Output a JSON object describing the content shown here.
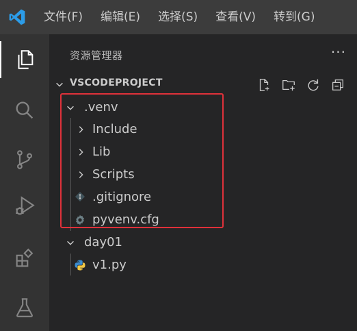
{
  "menu": {
    "items": [
      {
        "label": "文件(F)"
      },
      {
        "label": "编辑(E)"
      },
      {
        "label": "选择(S)"
      },
      {
        "label": "查看(V)"
      },
      {
        "label": "转到(G)"
      }
    ]
  },
  "activity_bar": {
    "items": [
      "explorer-icon",
      "search-icon",
      "source-control-icon",
      "run-debug-icon",
      "extensions-icon",
      "testing-icon"
    ],
    "active": "explorer-icon"
  },
  "sidebar": {
    "title": "资源管理器",
    "more_label": "···",
    "section": {
      "title": "VSCODEPROJECT",
      "actions": [
        "new-file-icon",
        "new-folder-icon",
        "refresh-icon",
        "collapse-all-icon"
      ]
    },
    "tree": [
      {
        "label": ".venv",
        "type": "folder",
        "expanded": true
      },
      {
        "label": "Include",
        "type": "folder",
        "expanded": false
      },
      {
        "label": "Lib",
        "type": "folder",
        "expanded": false
      },
      {
        "label": "Scripts",
        "type": "folder",
        "expanded": false
      },
      {
        "label": ".gitignore",
        "type": "file",
        "icon": "git-icon"
      },
      {
        "label": "pyvenv.cfg",
        "type": "file",
        "icon": "gear-icon"
      },
      {
        "label": "day01",
        "type": "folder",
        "expanded": true
      },
      {
        "label": "v1.py",
        "type": "file",
        "icon": "python-icon"
      }
    ]
  },
  "colors": {
    "accent_logo": "#2c9ce8",
    "highlight_border": "#e0313a",
    "python_blue": "#3b8ccf",
    "python_yellow": "#f2c744"
  }
}
